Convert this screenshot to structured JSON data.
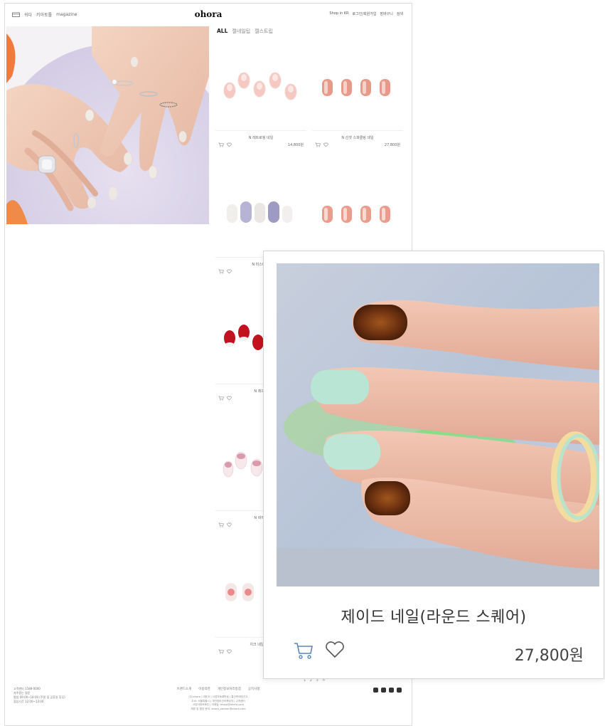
{
  "header": {
    "logo": "ohora",
    "left_nav": [
      "쉬다",
      "키아토톨",
      "magazine"
    ],
    "right_nav": [
      "Shop in KR",
      "로그인/회원가입",
      "장바구니",
      "검색"
    ]
  },
  "filters": [
    "ALL",
    "젤네일팁",
    "젤스트립"
  ],
  "products": [
    {
      "name": "N 레트로핑 네일",
      "price": "14,800원"
    },
    {
      "name": "N 선셋 스파클링 네일",
      "price": "27,800원"
    },
    {
      "name": "N 미스티 퍼",
      "price": ""
    },
    {
      "name": "",
      "price": ""
    },
    {
      "name": "N 레드로",
      "price": ""
    },
    {
      "name": "N 비이지",
      "price": ""
    },
    {
      "name": "치크 네일(피오",
      "price": ""
    }
  ],
  "pagination": "1 2 3 >",
  "footer": {
    "left": [
      "고객센터 1588-0000",
      "자주묻는 질문",
      "평일 09:00~18:00 (주말 및 공휴일 휴무)",
      "점심시간 12:00~13:00"
    ],
    "links": [
      "브랜드소개",
      "이용약관",
      "개인정보처리방침",
      "공지사항"
    ],
    "info": [
      "(주)ohora | 대표자 | 사업자등록번호 | 통신판매업신고",
      "주소: 서울특별시 | 개인정보관리책임자 | 고객센터",
      "사업자정보확인 | 이메일: ohora@ohora.com",
      "제휴 및 협업 문의: ohora_partner@ohora.com"
    ]
  },
  "zoom": {
    "name": "제이드 네일(라운드 스퀘어)",
    "price": "27,800원"
  }
}
